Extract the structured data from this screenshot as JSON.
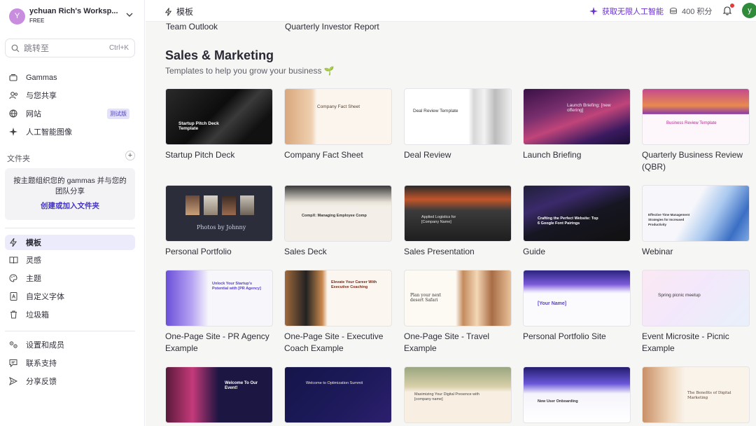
{
  "workspace": {
    "avatar": "Y",
    "name": "ychuan Rich's Worksp...",
    "plan": "FREE"
  },
  "search": {
    "placeholder": "跳转至",
    "shortcut": "Ctrl+K"
  },
  "nav_primary": [
    {
      "label": "Gammas",
      "icon": "gammas-icon"
    },
    {
      "label": "与您共享",
      "icon": "shared-users-icon"
    },
    {
      "label": "网站",
      "icon": "globe-icon",
      "badge": "测试版"
    },
    {
      "label": "人工智能图像",
      "icon": "sparkle-icon"
    }
  ],
  "folders": {
    "heading": "文件夹",
    "empty_text": "按主题组织您的 gammas 并与您的团队分享",
    "create_link": "创建或加入文件夹"
  },
  "nav_secondary": [
    {
      "label": "模板",
      "icon": "bolt-icon",
      "active": true
    },
    {
      "label": "灵感",
      "icon": "book-icon"
    },
    {
      "label": "主题",
      "icon": "palette-icon"
    },
    {
      "label": "自定义字体",
      "icon": "font-file-icon"
    },
    {
      "label": "垃圾箱",
      "icon": "trash-icon"
    }
  ],
  "nav_footer": [
    {
      "label": "设置和成员",
      "icon": "settings-icon"
    },
    {
      "label": "联系支持",
      "icon": "chat-icon"
    },
    {
      "label": "分享反馈",
      "icon": "send-icon"
    }
  ],
  "header": {
    "page_title": "模板",
    "ai_promo": "获取无限人工智能",
    "credits": "400 积分",
    "user_avatar": "y"
  },
  "previous_row": [
    "Team Outlook",
    "Quarterly Investor Report"
  ],
  "section": {
    "title": "Sales & Marketing",
    "subtitle": "Templates to help you grow your business 🌱"
  },
  "templates": [
    {
      "name": "Startup Pitch Deck",
      "thumb_text": "Startup Pitch Deck Template"
    },
    {
      "name": "Company Fact Sheet",
      "thumb_text": "Company Fact Sheet"
    },
    {
      "name": "Deal Review",
      "thumb_text": "Deal Review Template"
    },
    {
      "name": "Launch Briefing",
      "thumb_text": "Launch Briefing: [new offering]"
    },
    {
      "name": "Quarterly Business Review (QBR)",
      "thumb_text": "Business Review Template"
    },
    {
      "name": "Personal Portfolio",
      "thumb_text": "Photos by Johnny"
    },
    {
      "name": "Sales Deck",
      "thumb_text": "CompX: Managing Employee Comp"
    },
    {
      "name": "Sales Presentation",
      "thumb_text": "Applied Logistics for [Company Name]"
    },
    {
      "name": "Guide",
      "thumb_text": "Crafting the Perfect Website: Top 6 Google Font Pairings"
    },
    {
      "name": "Webinar",
      "thumb_text": "Effective Time Management Strategies for Increased Productivity"
    },
    {
      "name": "One-Page Site - PR Agency Example",
      "thumb_text": "Unlock Your Startup's Potential with [PR Agency]"
    },
    {
      "name": "One-Page Site - Executive Coach Example",
      "thumb_text": "Elevate Your Career With Executive Coaching"
    },
    {
      "name": "One-Page Site - Travel Example",
      "thumb_text": "Plan your next desert Safari"
    },
    {
      "name": "Personal Portfolio Site",
      "thumb_text": "[Your Name]"
    },
    {
      "name": "Event Microsite - Picnic Example",
      "thumb_text": "Spring picnic meetup"
    },
    {
      "name": "",
      "thumb_text": "Welcome To Our Event!"
    },
    {
      "name": "",
      "thumb_text": "Welcome to Optimization Summit"
    },
    {
      "name": "",
      "thumb_text": "Maximizing Your Digital Presence with [company name]"
    },
    {
      "name": "",
      "thumb_text": "New User Onboarding"
    },
    {
      "name": "",
      "thumb_text": "The Benefits of Digital Marketing"
    }
  ]
}
